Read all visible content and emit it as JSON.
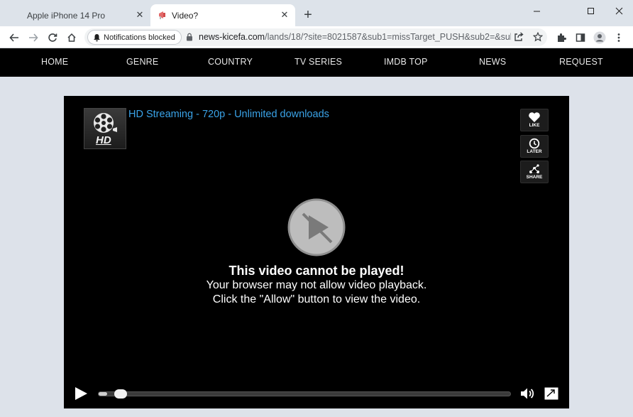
{
  "browser": {
    "tabs": [
      {
        "title": "Apple iPhone 14 Pro",
        "active": false
      },
      {
        "title": "Video?",
        "active": true
      }
    ],
    "window_controls": [
      "minimize",
      "maximize",
      "close"
    ],
    "notification_chip": "Notifications blocked",
    "url_host": "news-kicefa.com",
    "url_path": "/lands/18/?site=8021587&sub1=missTarget_PUSH&sub2=&sub..."
  },
  "site_nav": {
    "items": [
      "HOME",
      "GENRE",
      "COUNTRY",
      "TV SERIES",
      "IMDB TOP",
      "NEWS",
      "REQUEST"
    ]
  },
  "player": {
    "title": "HD Streaming - 720p - Unlimited downloads",
    "thumb_label": "HD",
    "side_buttons": [
      {
        "label": "LIKE",
        "icon": "heart-icon"
      },
      {
        "label": "LATER",
        "icon": "clock-icon"
      },
      {
        "label": "SHARE",
        "icon": "share-icon"
      }
    ],
    "message": {
      "title": "This video cannot be played!",
      "line1": "Your browser may not allow video playback.",
      "line2": "Click the \"Allow\" button to view the video."
    },
    "progress_fraction": 0.02
  },
  "colors": {
    "accent_title": "#3aa3e8",
    "nav_bg": "#000000",
    "page_bg": "#dde2ea"
  }
}
